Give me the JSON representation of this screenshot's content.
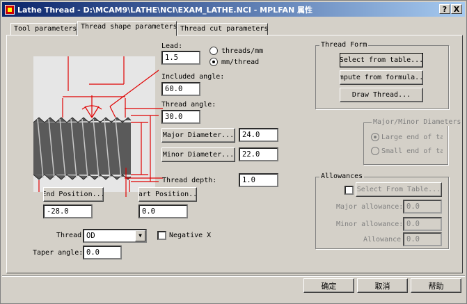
{
  "window": {
    "title": "Lathe Thread - D:\\MCAM9\\LATHE\\NCI\\EXAM_LATHE.NCI - MPLFAN 属性",
    "help_label": "?",
    "close_label": "X"
  },
  "tabs": [
    {
      "label": "Tool parameters"
    },
    {
      "label": "Thread shape parameters"
    },
    {
      "label": "Thread cut parameters"
    }
  ],
  "lead": {
    "label": "Lead:",
    "value": "1.5"
  },
  "units": {
    "threads_label": "threads/mm",
    "mm_label": "mm/thread",
    "selected": "mm/thread"
  },
  "included_angle": {
    "label": "Included angle:",
    "value": "60.0"
  },
  "thread_angle": {
    "label": "Thread angle:",
    "value": "30.0"
  },
  "major_diameter": {
    "button": "Major Diameter...",
    "value": "24.0"
  },
  "minor_diameter": {
    "button": "Minor Diameter...",
    "value": "22.0"
  },
  "thread_depth": {
    "label": "Thread depth:",
    "value": "1.0"
  },
  "end_position": {
    "button": "End Position...",
    "value": "-28.0"
  },
  "start_position": {
    "button": "tart Position...",
    "value": "0.0"
  },
  "thread": {
    "label": "Thread",
    "value": "OD"
  },
  "negative_x": {
    "label": "Negative X",
    "checked": false
  },
  "taper_angle": {
    "label": "Taper angle:",
    "value": "0.0"
  },
  "thread_form": {
    "title": "Thread Form",
    "select_table": "Select from table...",
    "compute_formula": "ompute from formula...",
    "draw_thread": "Draw Thread..."
  },
  "major_minor": {
    "title": "Major/Minor Diameters",
    "large": "Large end of taj",
    "small": "Small end of taj",
    "selected": "Large end of taj"
  },
  "allowances": {
    "title": "Allowances",
    "select_table": "Select From Table...",
    "major_label": "Major allowance:",
    "major_value": "0.0",
    "minor_label": "Minor allowance:",
    "minor_value": "0.0",
    "allowance_label": "Allowance",
    "allowance_value": "0.0"
  },
  "footer": {
    "ok": "确定",
    "cancel": "取消",
    "help": "帮助"
  },
  "colors": {
    "title_start": "#0a246a",
    "title_end": "#a6caf0",
    "dimension_red": "#e00000",
    "diagram_bg": "#e6e6e6",
    "thread_dark": "#5a5a5a"
  }
}
